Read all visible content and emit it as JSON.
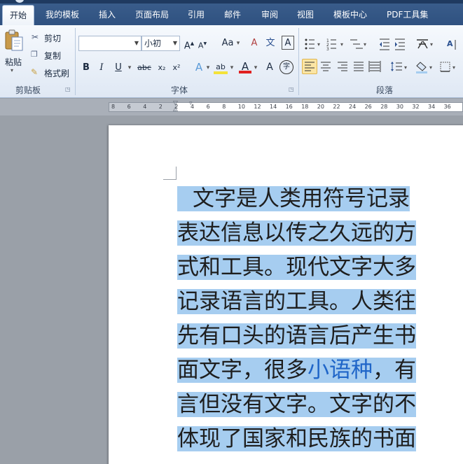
{
  "tabs": [
    {
      "label": "开始",
      "active": true
    },
    {
      "label": "我的模板"
    },
    {
      "label": "插入"
    },
    {
      "label": "页面布局"
    },
    {
      "label": "引用"
    },
    {
      "label": "邮件"
    },
    {
      "label": "审阅"
    },
    {
      "label": "视图"
    },
    {
      "label": "模板中心"
    },
    {
      "label": "PDF工具集"
    }
  ],
  "clipboard": {
    "paste_label": "粘贴",
    "cut_label": "剪切",
    "copy_label": "复制",
    "format_painter_label": "格式刷",
    "group_label": "剪贴板"
  },
  "font": {
    "font_name_value": "",
    "font_size_value": "小初",
    "grow_label": "A",
    "shrink_label": "A",
    "change_case_label": "Aa",
    "clear_format_label": "A",
    "phonetic_label": "文",
    "border_label": "A",
    "bold_label": "B",
    "italic_label": "I",
    "underline_label": "U",
    "strike_label": "abc",
    "subscript_label": "x₂",
    "superscript_label": "x²",
    "effects_label": "A",
    "highlight_label": "ab",
    "color_label": "A",
    "shading_label": "A",
    "enclose_label": "字",
    "group_label": "字体"
  },
  "paragraph": {
    "group_label": "段落",
    "sort_label": "A"
  },
  "ruler": {
    "ticks": [
      "8",
      "6",
      "4",
      "2",
      "2",
      "4",
      "6",
      "8",
      "10",
      "12",
      "14",
      "16",
      "18",
      "20",
      "22",
      "24",
      "26",
      "28",
      "30",
      "32",
      "34",
      "36"
    ]
  },
  "document": {
    "lines": [
      {
        "text": "文字是人类用符号记录"
      },
      {
        "text": "表达信息以传之久远的方"
      },
      {
        "text": "式和工具。现代文字大多"
      },
      {
        "text": "记录语言的工具。人类往"
      },
      {
        "text": "先有口头的语言后产生书"
      },
      {
        "pre": "面文字，很多",
        "link": "小语种",
        "post": "，有"
      },
      {
        "text": "言但没有文字。文字的不"
      },
      {
        "text": "体现了国家和民族的书面"
      }
    ]
  },
  "colors": {
    "tab_bar": "#2f5180",
    "selection": "#a6cdf0",
    "link": "#1f65c8",
    "font_color_red": "#e02020",
    "highlight_yellow": "#f4e23a"
  }
}
